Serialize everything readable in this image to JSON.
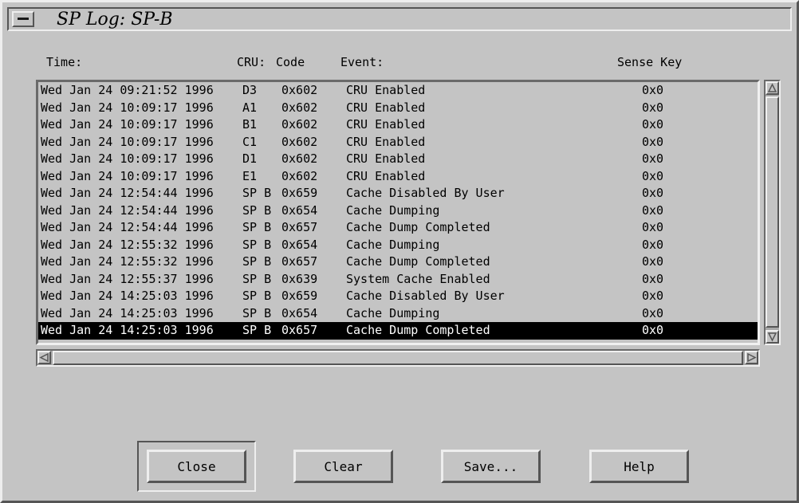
{
  "window": {
    "title": "SP Log: SP-B"
  },
  "headers": {
    "time": "Time:",
    "cru": "CRU:",
    "code": "Code",
    "event": "Event:",
    "sense": "Sense Key"
  },
  "rows": [
    {
      "time": "Wed Jan 24 09:21:52 1996",
      "cru": "D3",
      "code": "0x602",
      "event": "CRU Enabled",
      "sense": "0x0"
    },
    {
      "time": "Wed Jan 24 10:09:17 1996",
      "cru": "A1",
      "code": "0x602",
      "event": "CRU Enabled",
      "sense": "0x0"
    },
    {
      "time": "Wed Jan 24 10:09:17 1996",
      "cru": "B1",
      "code": "0x602",
      "event": "CRU Enabled",
      "sense": "0x0"
    },
    {
      "time": "Wed Jan 24 10:09:17 1996",
      "cru": "C1",
      "code": "0x602",
      "event": "CRU Enabled",
      "sense": "0x0"
    },
    {
      "time": "Wed Jan 24 10:09:17 1996",
      "cru": "D1",
      "code": "0x602",
      "event": "CRU Enabled",
      "sense": "0x0"
    },
    {
      "time": "Wed Jan 24 10:09:17 1996",
      "cru": "E1",
      "code": "0x602",
      "event": "CRU Enabled",
      "sense": "0x0"
    },
    {
      "time": "Wed Jan 24 12:54:44 1996",
      "cru": "SP B",
      "code": "0x659",
      "event": "Cache Disabled By User",
      "sense": "0x0"
    },
    {
      "time": "Wed Jan 24 12:54:44 1996",
      "cru": "SP B",
      "code": "0x654",
      "event": "Cache Dumping",
      "sense": "0x0"
    },
    {
      "time": "Wed Jan 24 12:54:44 1996",
      "cru": "SP B",
      "code": "0x657",
      "event": "Cache Dump Completed",
      "sense": "0x0"
    },
    {
      "time": "Wed Jan 24 12:55:32 1996",
      "cru": "SP B",
      "code": "0x654",
      "event": "Cache Dumping",
      "sense": "0x0"
    },
    {
      "time": "Wed Jan 24 12:55:32 1996",
      "cru": "SP B",
      "code": "0x657",
      "event": "Cache Dump Completed",
      "sense": "0x0"
    },
    {
      "time": "Wed Jan 24 12:55:37 1996",
      "cru": "SP B",
      "code": "0x639",
      "event": "System Cache Enabled",
      "sense": "0x0"
    },
    {
      "time": "Wed Jan 24 14:25:03 1996",
      "cru": "SP B",
      "code": "0x659",
      "event": "Cache Disabled By User",
      "sense": "0x0"
    },
    {
      "time": "Wed Jan 24 14:25:03 1996",
      "cru": "SP B",
      "code": "0x654",
      "event": "Cache Dumping",
      "sense": "0x0"
    },
    {
      "time": "Wed Jan 24 14:25:03 1996",
      "cru": "SP B",
      "code": "0x657",
      "event": "Cache Dump Completed",
      "sense": "0x0",
      "selected": true
    }
  ],
  "buttons": {
    "close": "Close",
    "clear": "Clear",
    "save": "Save...",
    "help": "Help"
  },
  "icons": {
    "window_menu": "window-menu-icon",
    "up": "arrow-up-icon",
    "down": "arrow-down-icon",
    "left": "arrow-left-icon",
    "right": "arrow-right-icon"
  },
  "colors": {
    "background": "#c4c4c4",
    "selection": "#000000",
    "selection_text": "#ffffff"
  }
}
